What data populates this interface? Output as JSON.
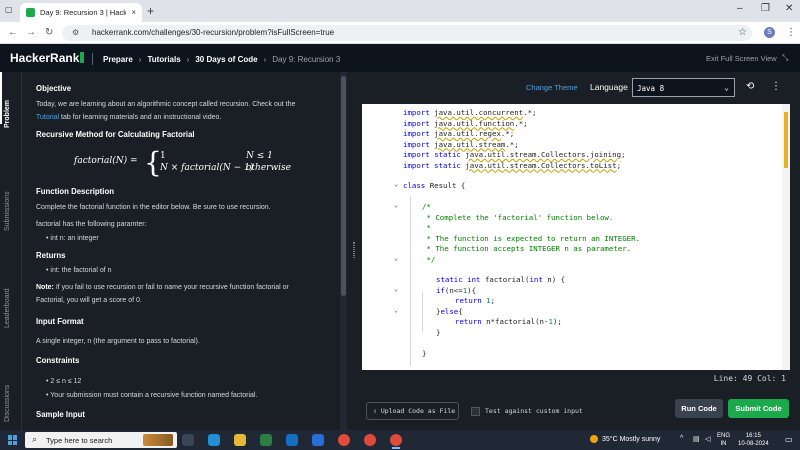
{
  "browser": {
    "tab_title": "Day 9: Recursion 3 | HackerRank",
    "tab_close": "×",
    "new_tab": "+",
    "url": "hackerrank.com/challenges/30-recursion/problem?isFullScreen=true",
    "profile_initial": "S"
  },
  "header": {
    "logo": "HackerRank",
    "breadcrumbs": [
      "Prepare",
      "Tutorials",
      "30 Days of Code",
      "Day 9: Recursion 3"
    ],
    "exit_fullscreen": "Exit Full Screen View"
  },
  "side_tabs": [
    "Problem",
    "Submissions",
    "Leaderboard",
    "Discussions"
  ],
  "problem": {
    "objective_heading": "Objective",
    "objective_text_1": "Today, we are learning about an algorithmic concept called recursion. Check out the",
    "objective_link": "Tutorial",
    "objective_text_2": " tab for learning materials and an instructional video.",
    "recursive_heading": "Recursive Method for Calculating Factorial",
    "formula_lhs": "factorial(N) =",
    "formula_case1": "1",
    "formula_case1_cond": "N ≤ 1",
    "formula_case2": "N × factorial(N − 1)",
    "formula_case2_cond": "otherwise",
    "function_heading": "Function Description",
    "function_text": "Complete the factorial function in the editor below. Be sure to use recursion.",
    "params_text": "factorial has the following paramter:",
    "param_1": "int n: an integer",
    "returns_heading": "Returns",
    "returns_1": "int: the factorial of n",
    "note_label": "Note:",
    "note_text_1": " If you fail to use recursion or fail to name your recursive function factorial or",
    "note_text_2": "Factorial, you will get a score of 0.",
    "input_heading": "Input Format",
    "input_text": "A single integer, n (the argument to pass to factorial).",
    "constraints_heading": "Constraints",
    "constraint_1": "2 ≤ n ≤ 12",
    "constraint_2": "Your submission must contain a recursive function named factorial.",
    "sample_heading": "Sample Input"
  },
  "editor": {
    "change_theme": "Change Theme",
    "language_label": "Language",
    "language_value": "Java 8",
    "code": {
      "l1a": "import ",
      "l1b": "java.util.concurrent",
      "l1c": ".*;",
      "l2a": "import ",
      "l2b": "java.util.function",
      "l2c": ".*;",
      "l3a": "import ",
      "l3b": "java.util.regex",
      "l3c": ".*;",
      "l4a": "import ",
      "l4b": "java.util.stream",
      "l4c": ".*;",
      "l5a": "import static ",
      "l5b": "java.util.stream.Collectors.joining",
      "l5c": ";",
      "l6a": "import static ",
      "l6b": "java.util.stream.Collectors.toList",
      "l6c": ";",
      "l7a": "class ",
      "l7b": "Result {",
      "l8": "/*",
      "l9": " * Complete the 'factorial' function below.",
      "l10": " *",
      "l11": " * The function is expected to return an INTEGER.",
      "l12": " * The function accepts INTEGER n as parameter.",
      "l13": " */",
      "l14a": "static int ",
      "l14b": "factorial(",
      "l14c": "int ",
      "l14d": "n) {",
      "l15a": "if",
      "l15b": "(n<=",
      "l15c": "1",
      "l15d": "){",
      "l16a": "return ",
      "l16b": "1",
      "l16c": ";",
      "l17a": "}",
      "l17b": "else",
      "l17c": "{",
      "l18a": "return ",
      "l18b": "n*factorial(n-",
      "l18c": "1",
      "l18d": ");",
      "l19": "}",
      "l20": "}"
    },
    "line_info": "Line: 49 Col: 1"
  },
  "actions": {
    "upload": "Upload Code as File",
    "custom_input": "Test against custom input",
    "run": "Run Code",
    "submit": "Submit Code"
  },
  "taskbar": {
    "search_placeholder": "Type here to search",
    "weather": "35°C  Mostly sunny",
    "lang_1": "ENG",
    "lang_2": "IN",
    "time": "16:15",
    "date": "10-08-2024"
  }
}
